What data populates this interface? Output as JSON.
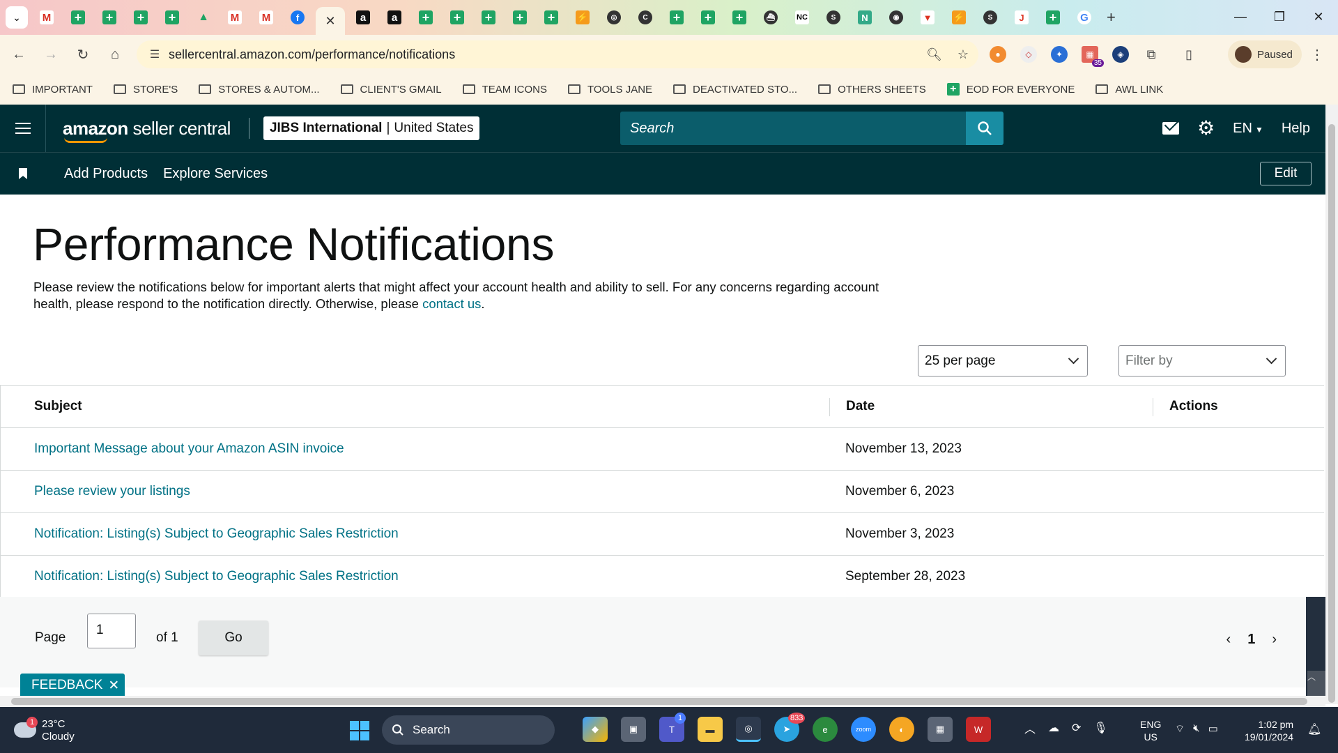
{
  "browser": {
    "tabs": [
      {
        "icon": "gmail-icon",
        "glyph": "M"
      },
      {
        "icon": "sheets-icon",
        "glyph": ""
      },
      {
        "icon": "sheets-icon",
        "glyph": ""
      },
      {
        "icon": "sheets-icon",
        "glyph": ""
      },
      {
        "icon": "sheets-icon",
        "glyph": ""
      },
      {
        "icon": "drive-icon",
        "glyph": "▲"
      },
      {
        "icon": "gmail-icon",
        "glyph": "M"
      },
      {
        "icon": "gmail-icon",
        "glyph": "M"
      },
      {
        "icon": "facebook-icon",
        "glyph": "f"
      }
    ],
    "tabs_after": [
      {
        "icon": "amazon-icon",
        "glyph": "a"
      },
      {
        "icon": "amazon-icon",
        "glyph": "a"
      },
      {
        "icon": "sheets-icon",
        "glyph": ""
      },
      {
        "icon": "sheets-icon",
        "glyph": ""
      },
      {
        "icon": "sheets-icon",
        "glyph": ""
      },
      {
        "icon": "sheets-icon",
        "glyph": ""
      },
      {
        "icon": "sheets-icon",
        "glyph": ""
      },
      {
        "icon": "orange-app-icon",
        "glyph": "⚡"
      },
      {
        "icon": "globe-icon",
        "glyph": "◎"
      },
      {
        "icon": "c-app-icon",
        "glyph": "C"
      },
      {
        "icon": "sheets-icon",
        "glyph": ""
      },
      {
        "icon": "sheets-icon",
        "glyph": ""
      },
      {
        "icon": "sheets-icon",
        "glyph": ""
      },
      {
        "icon": "ship-icon",
        "glyph": "⛴"
      },
      {
        "icon": "nc-icon",
        "glyph": "NC"
      },
      {
        "icon": "sysco-icon",
        "glyph": "S"
      },
      {
        "icon": "n-app-icon",
        "glyph": "N"
      },
      {
        "icon": "circle-app-icon",
        "glyph": "◉"
      },
      {
        "icon": "red-app-icon",
        "glyph": "▼"
      },
      {
        "icon": "orange-app-icon",
        "glyph": "⚡"
      },
      {
        "icon": "stan-icon",
        "glyph": "S"
      },
      {
        "icon": "jt-icon",
        "glyph": "J"
      },
      {
        "icon": "sheets-icon",
        "glyph": ""
      },
      {
        "icon": "google-icon",
        "glyph": "G"
      }
    ],
    "url": "sellercentral.amazon.com/performance/notifications",
    "profile_label": "Paused",
    "extension_badge": "35",
    "bookmarks": [
      {
        "label": "IMPORTANT",
        "type": "folder"
      },
      {
        "label": "STORE'S",
        "type": "folder"
      },
      {
        "label": "STORES & AUTOM...",
        "type": "folder"
      },
      {
        "label": "CLIENT'S GMAIL",
        "type": "folder"
      },
      {
        "label": "TEAM ICONS",
        "type": "folder"
      },
      {
        "label": "TOOLS JANE",
        "type": "folder"
      },
      {
        "label": "DEACTIVATED STO...",
        "type": "folder"
      },
      {
        "label": "OTHERS SHEETS",
        "type": "folder"
      },
      {
        "label": "EOD FOR EVERYONE",
        "type": "sheet"
      },
      {
        "label": "AWL LINK",
        "type": "folder"
      }
    ]
  },
  "header": {
    "logo_bold": "amazon",
    "logo_rest": " seller central",
    "store_name": "JIBS International",
    "separator": "|",
    "marketplace": "United States",
    "search_placeholder": "Search",
    "language": "EN",
    "help_label": "Help"
  },
  "subnav": {
    "links": [
      "Add Products",
      "Explore Services"
    ],
    "edit_label": "Edit"
  },
  "page": {
    "title": "Performance Notifications",
    "intro_text": "Please review the notifications below for important alerts that might affect your account health and ability to sell. For any concerns regarding account health, please respond to the notification directly. Otherwise, please ",
    "intro_link": "contact us",
    "intro_end": ".",
    "per_page": "25 per page",
    "filter_placeholder": "Filter by"
  },
  "table": {
    "columns": [
      "Subject",
      "Date",
      "Actions"
    ],
    "rows": [
      {
        "subject": "Important Message about your Amazon ASIN invoice",
        "date": "November 13, 2023"
      },
      {
        "subject": "Please review your listings",
        "date": "November 6, 2023"
      },
      {
        "subject": "Notification: Listing(s) Subject to Geographic Sales Restriction",
        "date": "November 3, 2023"
      },
      {
        "subject": "Notification: Listing(s) Subject to Geographic Sales Restriction",
        "date": "September 28, 2023"
      }
    ]
  },
  "pagination": {
    "page_label": "Page",
    "page_value": "1",
    "of_label": "of 1",
    "go_label": "Go",
    "current_page": "1"
  },
  "feedback_label": "FEEDBACK",
  "taskbar": {
    "temperature": "23°C",
    "condition": "Cloudy",
    "weather_badge": "1",
    "search_label": "Search",
    "lang_line1": "ENG",
    "lang_line2": "US",
    "time": "1:02 pm",
    "date": "19/01/2024",
    "telegram_badge": "833",
    "teams_badge": "1"
  }
}
